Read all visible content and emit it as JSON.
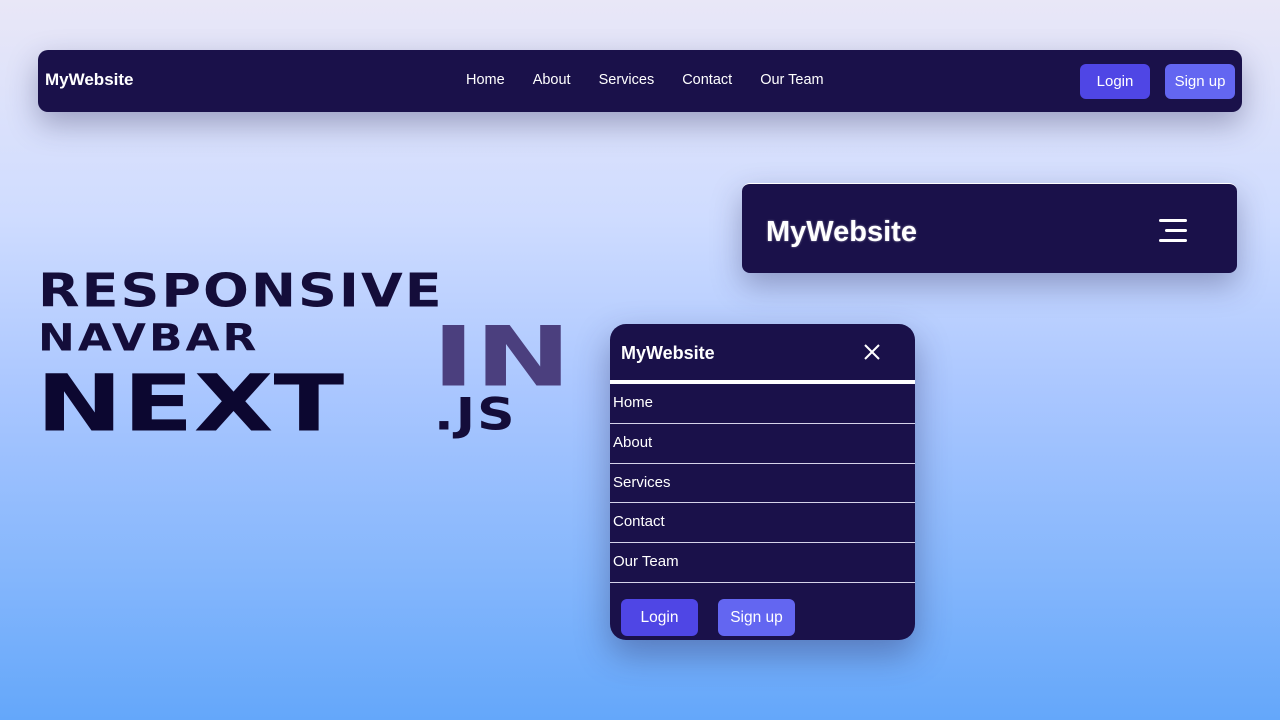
{
  "desktop_nav": {
    "logo": "MyWebsite",
    "links": [
      "Home",
      "About",
      "Services",
      "Contact",
      "Our Team"
    ],
    "login_label": "Login",
    "signup_label": "Sign up"
  },
  "tablet_nav": {
    "logo": "MyWebsite",
    "menu_icon": "hamburger-menu-icon"
  },
  "mobile_menu": {
    "logo": "MyWebsite",
    "close_icon": "close-icon",
    "links": [
      "Home",
      "About",
      "Services",
      "Contact",
      "Our Team"
    ],
    "login_label": "Login",
    "signup_label": "Sign up"
  },
  "headline": {
    "line1": "RESPONSIVE",
    "line2": "NAVBAR",
    "line3": "NEXT",
    "in": "IN",
    "js": ".JS"
  },
  "colors": {
    "nav_bg": "#1a114a",
    "primary_button": "#4f46e5",
    "secondary_button": "#6366f1",
    "headline_dark": "#140d3a",
    "headline_accent": "#4b3f7e"
  }
}
